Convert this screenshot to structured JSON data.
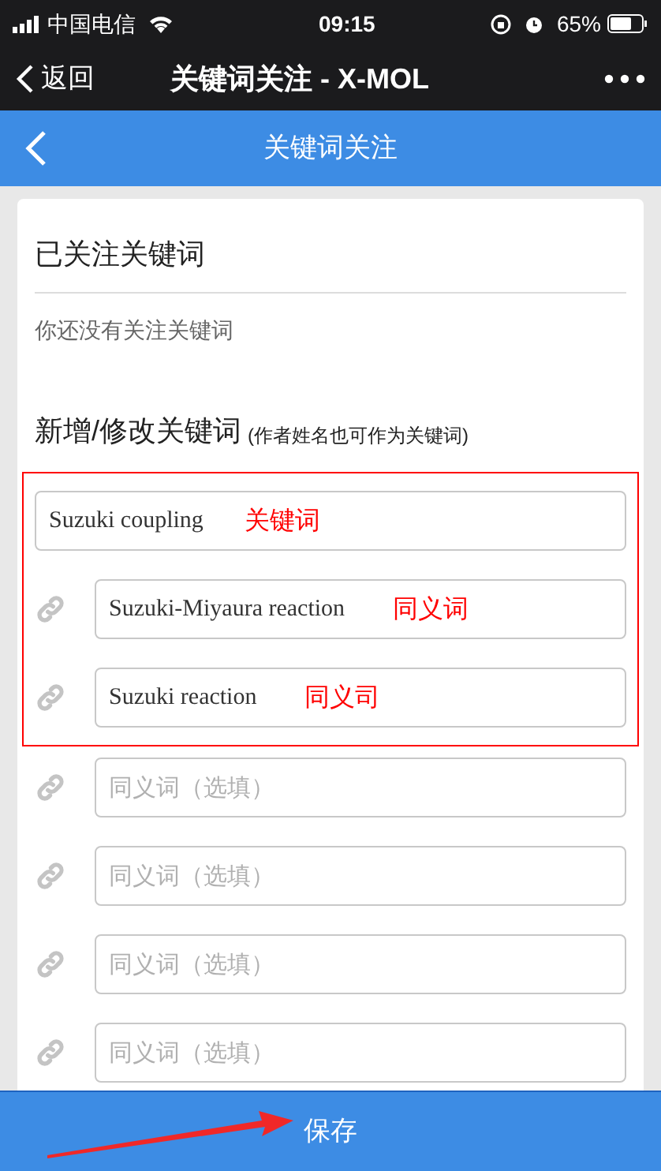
{
  "status_bar": {
    "carrier": "中国电信",
    "time": "09:15",
    "battery": "65%"
  },
  "nav": {
    "back": "返回",
    "title": "关键词关注 - X-MOL"
  },
  "header": {
    "title": "关键词关注"
  },
  "followed": {
    "title": "已关注关键词",
    "empty": "你还没有关注关键词"
  },
  "edit": {
    "title": "新增/修改关键词",
    "note": "(作者姓名也可作为关键词)"
  },
  "keyword": {
    "value": "Suzuki coupling",
    "annotation": "关键词"
  },
  "synonyms": [
    {
      "value": "Suzuki-Miyaura reaction",
      "annotation": "同义词"
    },
    {
      "value": "Suzuki reaction",
      "annotation": "同义司"
    },
    {
      "placeholder": "同义词（选填）"
    },
    {
      "placeholder": "同义词（选填）"
    },
    {
      "placeholder": "同义词（选填）"
    },
    {
      "placeholder": "同义词（选填）"
    }
  ],
  "save": "保存"
}
